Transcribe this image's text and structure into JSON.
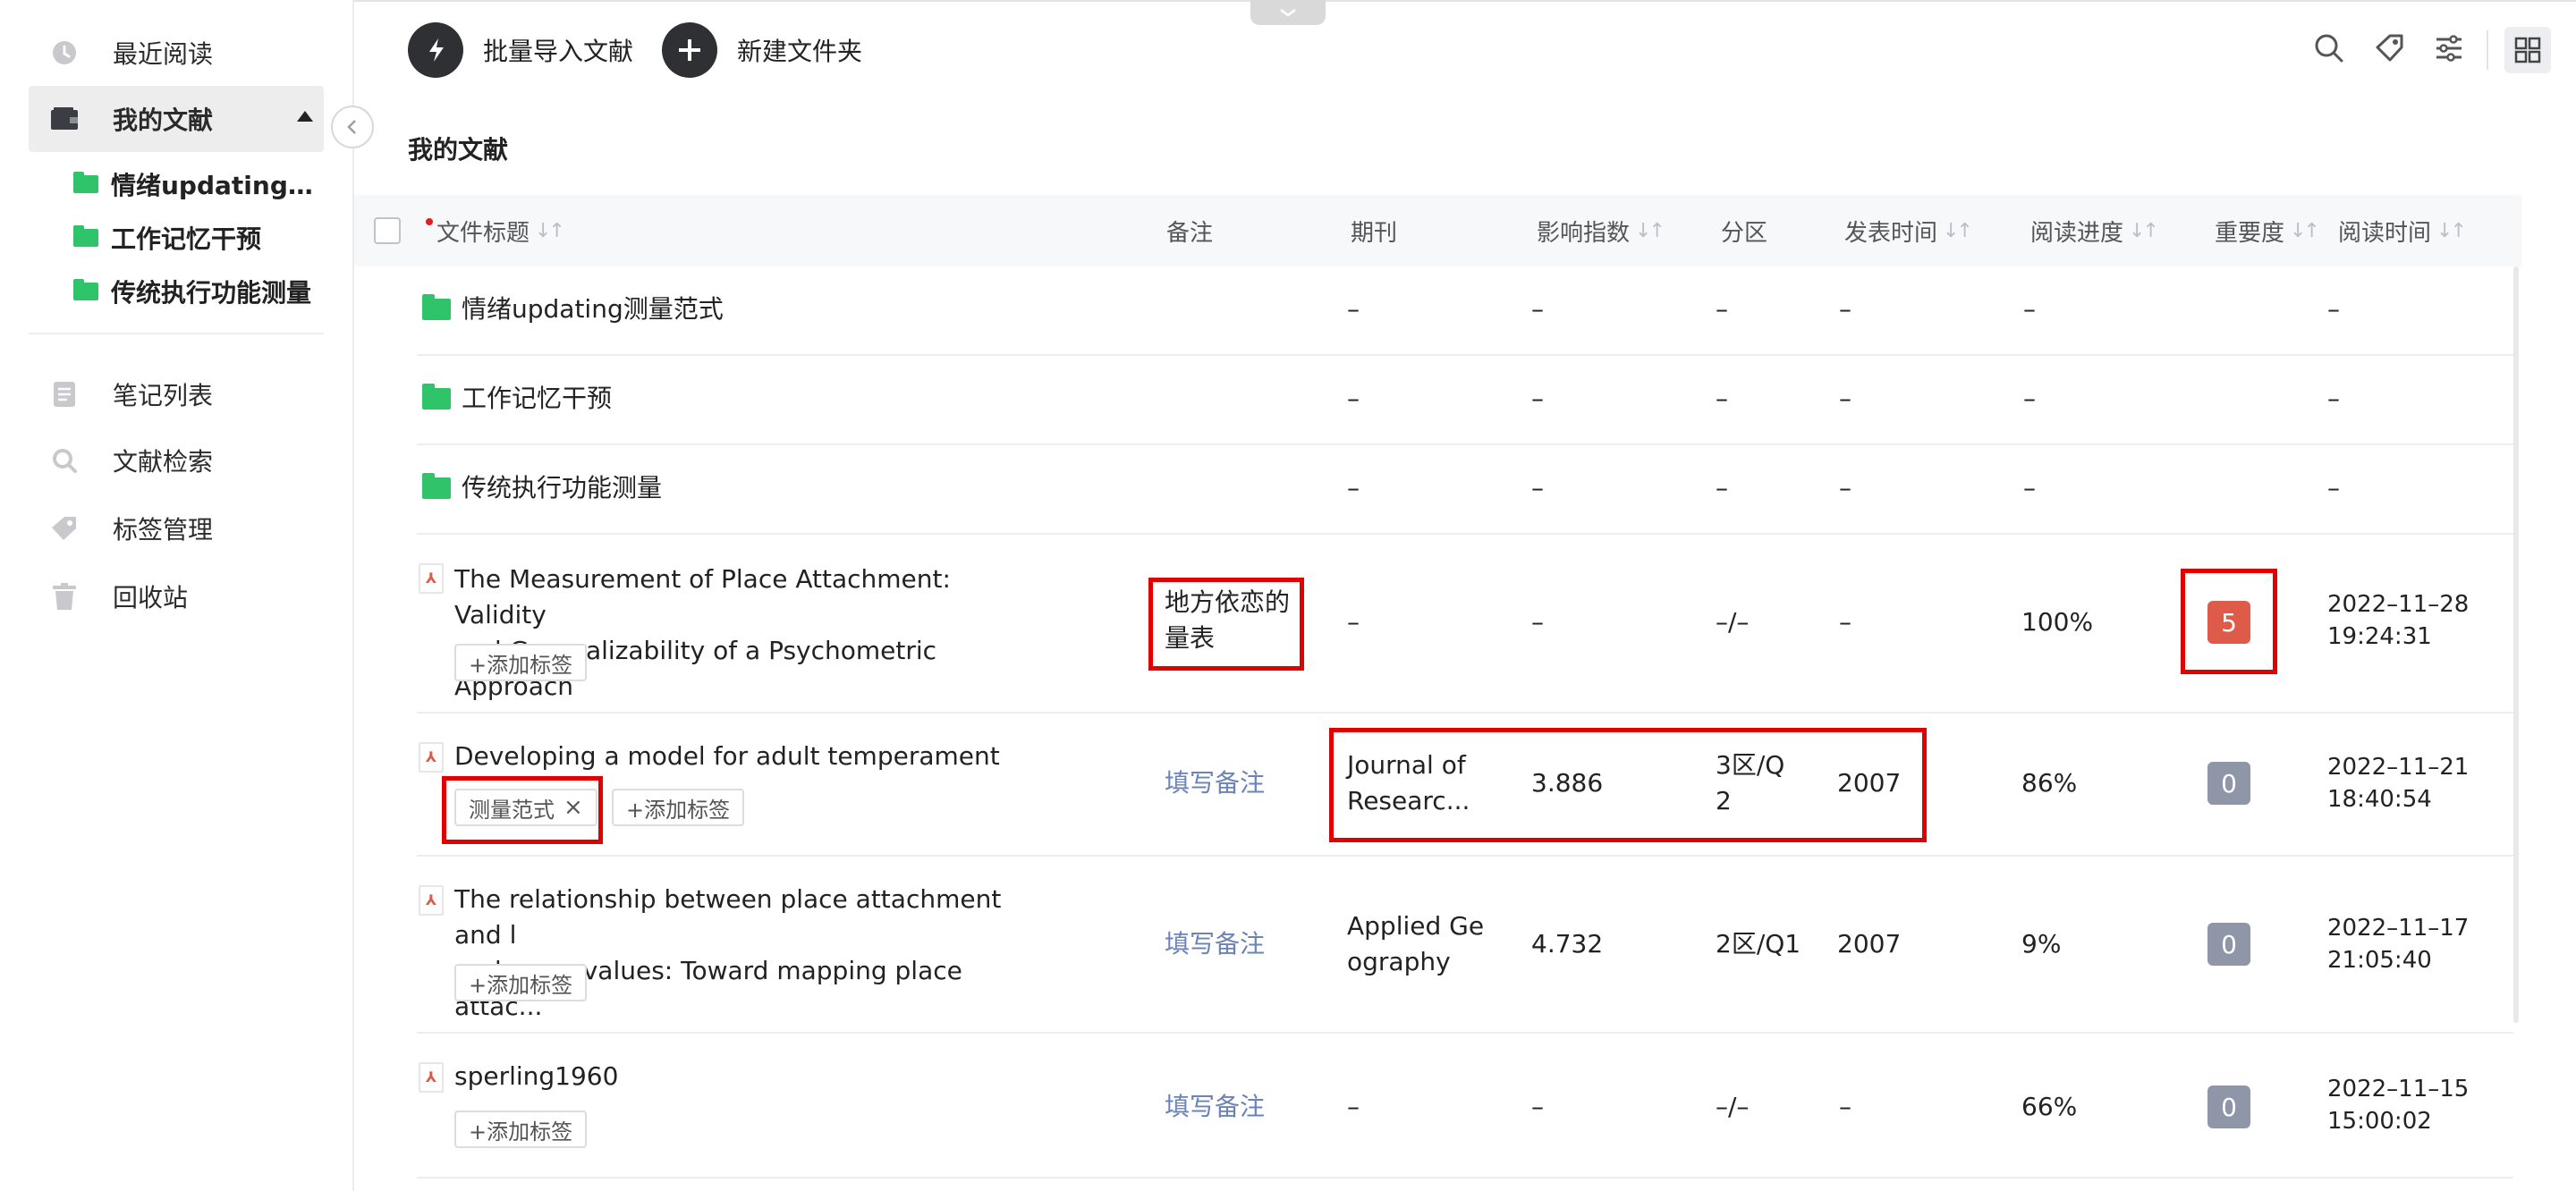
{
  "sidebar": {
    "recent": "最近阅读",
    "my_docs": "我的文献",
    "folders": [
      "情绪updating测...",
      "工作记忆干预",
      "传统执行功能测量"
    ],
    "notes": "笔记列表",
    "search": "文献检索",
    "tags": "标签管理",
    "trash": "回收站"
  },
  "toolbar": {
    "import_label": "批量导入文献",
    "new_folder_label": "新建文件夹"
  },
  "page_title": "我的文献",
  "columns": {
    "title": "文件标题",
    "note": "备注",
    "journal": "期刊",
    "impact": "影响指数",
    "zone": "分区",
    "pubdate": "发表时间",
    "progress": "阅读进度",
    "importance": "重要度",
    "readtime": "阅读时间"
  },
  "folders": [
    {
      "name": "情绪updating测量范式",
      "journal": "–",
      "impact": "–",
      "zone": "–",
      "pubdate": "–",
      "progress": "–",
      "readtime": "–"
    },
    {
      "name": "工作记忆干预",
      "journal": "–",
      "impact": "–",
      "zone": "–",
      "pubdate": "–",
      "progress": "–",
      "readtime": "–"
    },
    {
      "name": "传统执行功能测量",
      "journal": "–",
      "impact": "–",
      "zone": "–",
      "pubdate": "–",
      "progress": "–",
      "readtime": "–"
    }
  ],
  "papers": [
    {
      "title_line1": "The Measurement of Place Attachment: Validity",
      "title_line2": "and Generalizability of a Psychometric Approach",
      "add_tag": "+添加标签",
      "note_line1": "地方依恋的",
      "note_line2": "量表",
      "journal": "–",
      "impact": "–",
      "zone": "–/–",
      "pubdate": "–",
      "progress": "100%",
      "importance": "5",
      "date": "2022–11–28",
      "time": "19:24:31"
    },
    {
      "title_line1": "Developing a model for adult temperament",
      "tag": "测量范式",
      "tag_close": "×",
      "add_tag": "+添加标签",
      "note": "填写备注",
      "journal_line1": "Journal of",
      "journal_line2": "Researc...",
      "impact": "3.886",
      "zone_line1": "3区/Q",
      "zone_line2": "2",
      "pubdate": "2007",
      "progress": "86%",
      "importance": "0",
      "date": "2022–11–21",
      "time": "18:40:54"
    },
    {
      "title_line1": "The relationship between place attachment and l",
      "title_line2": "andscape values: Toward mapping place attac...",
      "add_tag": "+添加标签",
      "note": "填写备注",
      "journal_line1": "Applied Ge",
      "journal_line2": "ography",
      "impact": "4.732",
      "zone": "2区/Q1",
      "pubdate": "2007",
      "progress": "9%",
      "importance": "0",
      "date": "2022–11–17",
      "time": "21:05:40"
    },
    {
      "title_line1": "sperling1960",
      "add_tag": "+添加标签",
      "note": "填写备注",
      "journal": "–",
      "impact": "–",
      "zone": "–/–",
      "pubdate": "–",
      "progress": "66%",
      "importance": "0",
      "date": "2022–11–15",
      "time": "15:00:02"
    }
  ],
  "colors": {
    "accent_red": "#de5b4a",
    "badge_gray": "#8f96a8",
    "folder_green": "#2fc46a",
    "note_link": "#6a83b8",
    "highlight": "#e00000"
  }
}
